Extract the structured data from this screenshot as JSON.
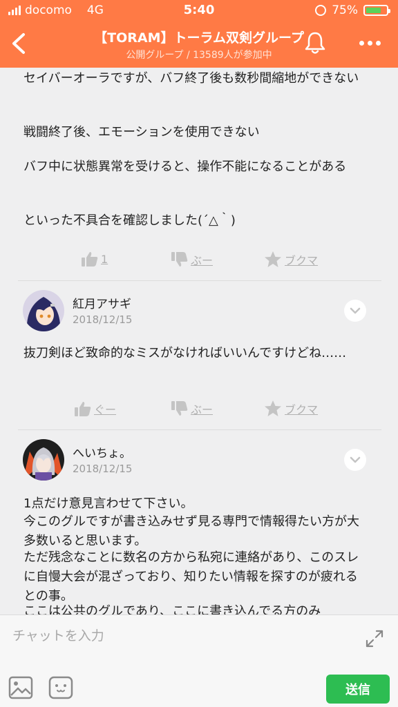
{
  "status_bar": {
    "carrier": "docomo",
    "network": "4G",
    "time": "5:40",
    "battery": "75%",
    "battery_level": 0.75
  },
  "header": {
    "title": "【TORAM】トーラム双剣グループ",
    "subtitle": "公開グループ / 13589人が参加中"
  },
  "posts": [
    {
      "lines": [
        "セイバーオーラですが、バフ終了後も数秒間縮地ができない",
        "戦闘終了後、エモーションを使用できない",
        "バフ中に状態異常を受けると、操作不能になることがある",
        "といった不具合を確認しました(´△｀)"
      ],
      "actions": {
        "like": "1",
        "dislike": "ぶー",
        "bookmark": "ブクマ"
      }
    },
    {
      "user": "紅月アサギ",
      "date": "2018/12/15",
      "text": "抜刀剣ほど致命的なミスがなければいいんですけどね……",
      "actions": {
        "like": "ぐー",
        "dislike": "ぶー",
        "bookmark": "ブクマ"
      }
    },
    {
      "user": "へいちょ。",
      "date": "2018/12/15",
      "text_lines": [
        "1点だけ意見言わせて下さい。",
        "今このグルですが書き込みせず見る専門で情報得たい方が大多数いると思います。",
        "ただ残念なことに数名の方から私宛に連絡があり、このスレに自慢大会が混ざっており、知りたい情報を探すのが疲れるとの事。",
        "ここは公共のグルであり、ここに書き込んでる方のみ"
      ]
    }
  ],
  "composer": {
    "placeholder": "チャットを入力",
    "send_label": "送信"
  },
  "colors": {
    "header": "#ff7a45",
    "send": "#2dbd52",
    "background": "#efeff0"
  }
}
